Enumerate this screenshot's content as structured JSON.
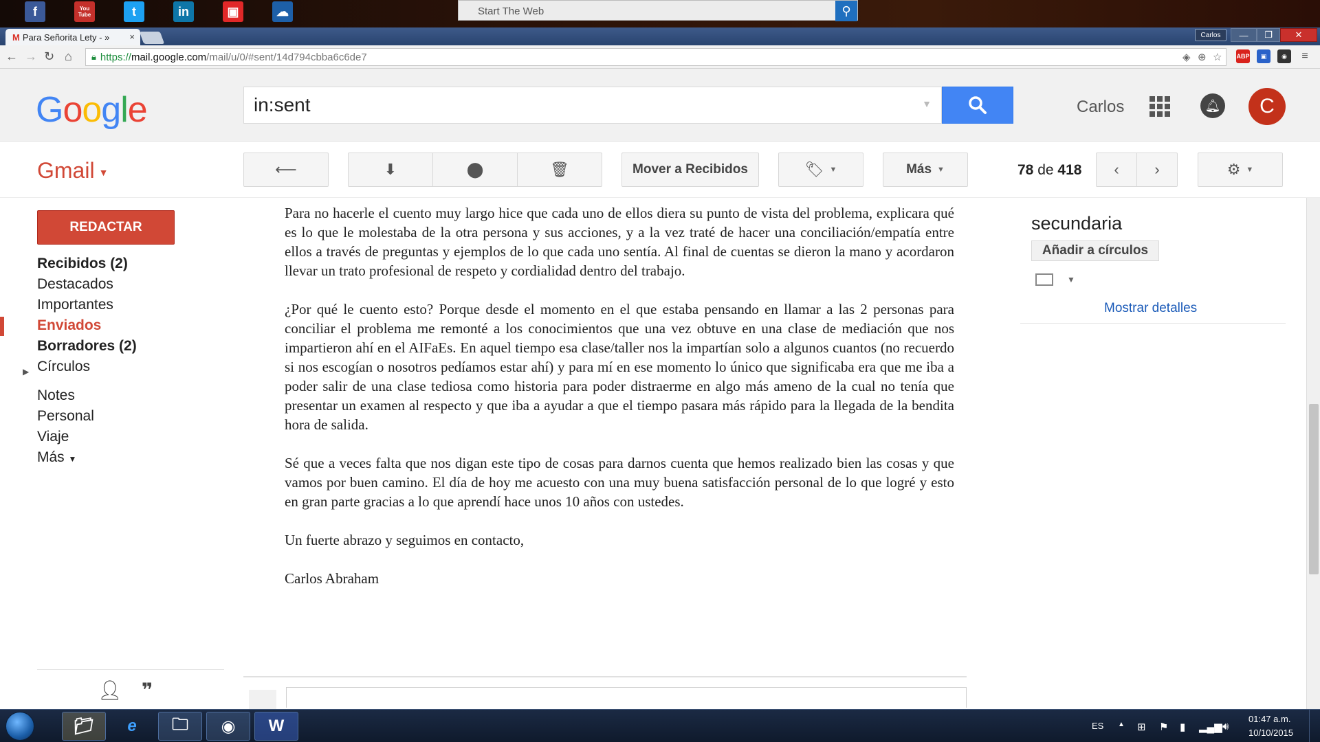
{
  "desktop": {
    "shortcuts": [
      {
        "name": "facebook",
        "label": "f",
        "color": "#3b5998"
      },
      {
        "name": "youtube",
        "label": "You Tube",
        "color": "#c4302b"
      },
      {
        "name": "twitter",
        "label": "t",
        "color": "#1da1f2"
      },
      {
        "name": "linkedin",
        "label": "in",
        "color": "#0e76a8"
      },
      {
        "name": "flipboard",
        "label": "▣",
        "color": "#e12828"
      },
      {
        "name": "weather",
        "label": "☁",
        "color": "#1d5fa8"
      }
    ],
    "startweb_placeholder": "Start The Web"
  },
  "browser": {
    "tab_title": "Para Señorita Lety - »",
    "tab_close": "×",
    "profile_chip": "Carlos",
    "url_scheme": "https://",
    "url_host": "mail.google.com",
    "url_path": "/mail/u/0/#sent/14d794cbba6c6de7",
    "ext_abp": "ABP"
  },
  "header": {
    "search_value": "in:sent",
    "user_name": "Carlos",
    "avatar_letter": "C"
  },
  "toolbar": {
    "gmail_label": "Gmail",
    "move_inbox": "Mover a Recibidos",
    "more": "Más",
    "pager_current": "78",
    "pager_sep": "de",
    "pager_total": "418"
  },
  "sidebar": {
    "compose": "REDACTAR",
    "items": [
      {
        "label": "Recibidos (2)"
      },
      {
        "label": "Destacados"
      },
      {
        "label": "Importantes"
      },
      {
        "label": "Enviados"
      },
      {
        "label": "Borradores (2)"
      },
      {
        "label": "Círculos"
      },
      {
        "label": "Notes"
      },
      {
        "label": "Personal"
      },
      {
        "label": "Viaje"
      },
      {
        "label": "Más"
      }
    ]
  },
  "email": {
    "paragraphs": [
      "Para no hacerle el cuento muy largo hice que cada uno de ellos diera su punto de vista del problema, explicara qué es lo que le molestaba de la otra persona y sus acciones, y a la vez traté de hacer una conciliación/empatía entre ellos a través de preguntas y ejemplos de lo que cada uno sentía. Al final de cuentas se dieron la mano y acordaron llevar un trato profesional de respeto y cordialidad dentro del trabajo.",
      "¿Por qué le cuento esto? Porque desde el momento en el que estaba pensando en llamar a las 2 personas para conciliar el problema me remonté a los conocimientos que una vez obtuve en una clase de mediación que nos impartieron ahí en el AIFaEs. En aquel tiempo esa clase/taller nos la impartían solo a algunos cuantos (no recuerdo si nos escogían o nosotros pedíamos estar ahí) y para mí en ese momento lo único que significaba era que me iba a poder salir de una clase tediosa como historia para poder distraerme en algo más ameno de la cual no tenía que presentar un examen al respecto y que iba a ayudar a que el tiempo pasara más rápido para la llegada de la bendita hora de salida.",
      "Sé que a veces falta que nos digan este tipo de cosas para darnos cuenta que hemos realizado bien las cosas y que vamos por buen camino. El día de hoy me acuesto con una muy buena satisfacción personal de lo que logré y esto en gran parte gracias a lo que aprendí hace unos 10 años con ustedes.",
      "Un fuerte abrazo y seguimos en contacto,",
      "Carlos Abraham"
    ]
  },
  "right_panel": {
    "title": "secundaria",
    "add_circles": "Añadir a círculos",
    "show_details": "Mostrar detalles"
  },
  "taskbar": {
    "lang": "ES",
    "time": "01:47 a.m.",
    "date": "10/10/2015"
  },
  "colors": {
    "gmail_red": "#d14836",
    "search_blue": "#4285f4",
    "link_blue": "#1a5ab8",
    "avatar_red": "#c3311a"
  }
}
